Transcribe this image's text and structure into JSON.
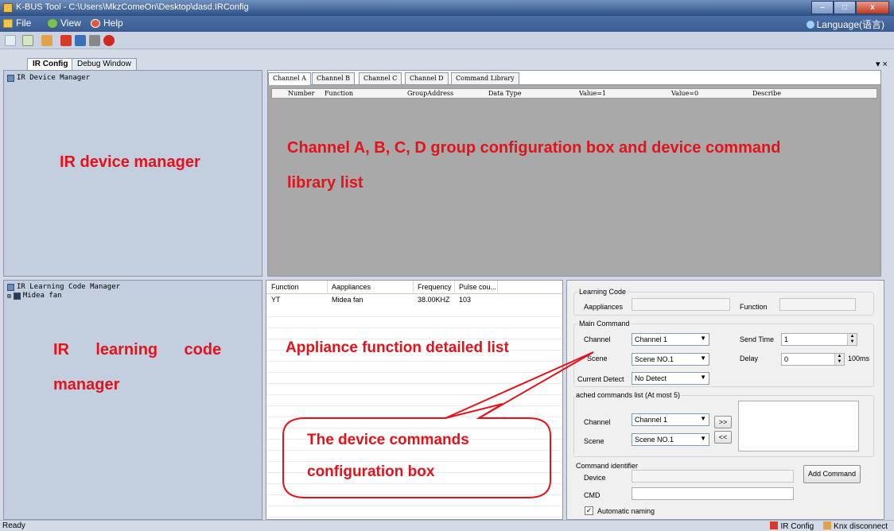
{
  "window": {
    "title": "K-BUS Tool - C:\\Users\\MkzComeOn\\Desktop\\dasd.IRConfig",
    "minimize": "–",
    "maximize": "□",
    "close": "x"
  },
  "menu": {
    "file": "File",
    "view": "View",
    "help": "Help",
    "language": "Language(语言)"
  },
  "toolbar": {
    "buttons": [
      "new-icon",
      "open-icon",
      "connect-icon",
      "record-icon",
      "save-icon",
      "print-icon",
      "stop-icon"
    ]
  },
  "doc_tabs": {
    "ir_config": "IR Config",
    "debug_window": "Debug Window",
    "dock_controls": "▾ ×"
  },
  "device_manager": {
    "title": "IR Device Manager",
    "annotation": "IR device manager"
  },
  "channel_tabs": [
    "Channel A",
    "Channel B",
    "Channel C",
    "Channel D",
    "Command Library"
  ],
  "channel_grid": {
    "columns": [
      "Number",
      "Function",
      "GroupAddress",
      "Data Type",
      "Value=1",
      "Value=0",
      "Describe"
    ],
    "annotation_line1": "Channel A, B, C, D group configuration box and device command",
    "annotation_line2": "library list"
  },
  "learning_manager": {
    "title": "IR Learning Code Manager",
    "tree_item": "Midea fan",
    "annotation_line1": "IR      learning      code",
    "annotation_line2": "manager"
  },
  "function_list": {
    "columns": [
      "Function",
      "Aappliances",
      "Frequency",
      "Pulse cou..."
    ],
    "rows": [
      [
        "YT",
        "Midea fan",
        "38.00KHZ",
        "103"
      ]
    ],
    "annotation": "Appliance function detailed list"
  },
  "config": {
    "learning_code_group": "Learning Code",
    "appliances_label": "Aappliances",
    "function_label": "Function",
    "main_command_group": "Main Command",
    "channel_label": "Channel",
    "channel_value": "Channel 1",
    "send_time_label": "Send Time",
    "send_time_value": "1",
    "scene_label": "Scene",
    "scene_value": "Scene NO.1",
    "delay_label": "Delay",
    "delay_value": "0",
    "delay_unit": "100ms",
    "current_detect_label": "Current Detect",
    "current_detect_value": "No Detect",
    "attached_group": "ached commands list (At most 5)",
    "attached_channel_label": "Channel",
    "attached_channel_value": "Channel 1",
    "attached_scene_label": "Scene",
    "attached_scene_value": "Scene NO.1",
    "add_btn": ">>",
    "remove_btn": "<<",
    "identifier_group": "Command identifier",
    "device_label": "Device",
    "cmd_label": "CMD",
    "add_command": "Add Command",
    "auto_naming": "Automatic naming",
    "auto_naming_checked": true
  },
  "callout": {
    "line1": "The device commands",
    "line2": "configuration box"
  },
  "status": {
    "ready": "Ready",
    "ir_config": "IR Config",
    "knx": "Knx disconnect"
  },
  "colors": {
    "annotation": "#e3131c",
    "title_bar": "#2c4f86",
    "left_panel": "#c3cede",
    "grid_bg": "#a9a9a9"
  }
}
